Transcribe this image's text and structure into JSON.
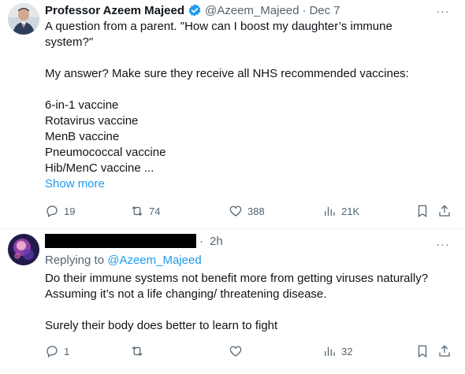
{
  "tweets": [
    {
      "author_name": "Professor Azeem Majeed",
      "handle": "@Azeem_Majeed",
      "separator": "·",
      "time": "Dec 7",
      "lines": [
        "A question from a parent. \"How can I boost my daughter’s immune",
        "system?\"",
        "",
        "My answer? Make sure they receive all NHS recommended vaccines:",
        "",
        "6-in-1 vaccine",
        "Rotavirus vaccine",
        "MenB vaccine",
        "Pneumococcal vaccine",
        "Hib/MenC vaccine ..."
      ],
      "show_more": "Show more",
      "replies": "19",
      "retweets": "74",
      "likes": "388",
      "views": "21K",
      "more_glyph": "···"
    },
    {
      "time": "2h",
      "separator": "·",
      "replying_prefix": "Replying to",
      "replying_to": "@Azeem_Majeed",
      "lines": [
        "Do their immune systems not benefit more from getting viruses naturally?",
        "Assuming it’s not a life changing/ threatening disease.",
        "",
        "Surely their body does better to learn to fight"
      ],
      "replies": "1",
      "retweets": "",
      "likes": "",
      "views": "32",
      "more_glyph": "···"
    }
  ],
  "colors": {
    "accent": "#1d9bf0",
    "secondary_text": "#536471",
    "primary_text": "#0f1419"
  },
  "icons": [
    "verified-badge-icon",
    "more-icon",
    "reply-icon",
    "retweet-icon",
    "like-icon",
    "views-icon",
    "bookmark-icon",
    "share-icon"
  ]
}
